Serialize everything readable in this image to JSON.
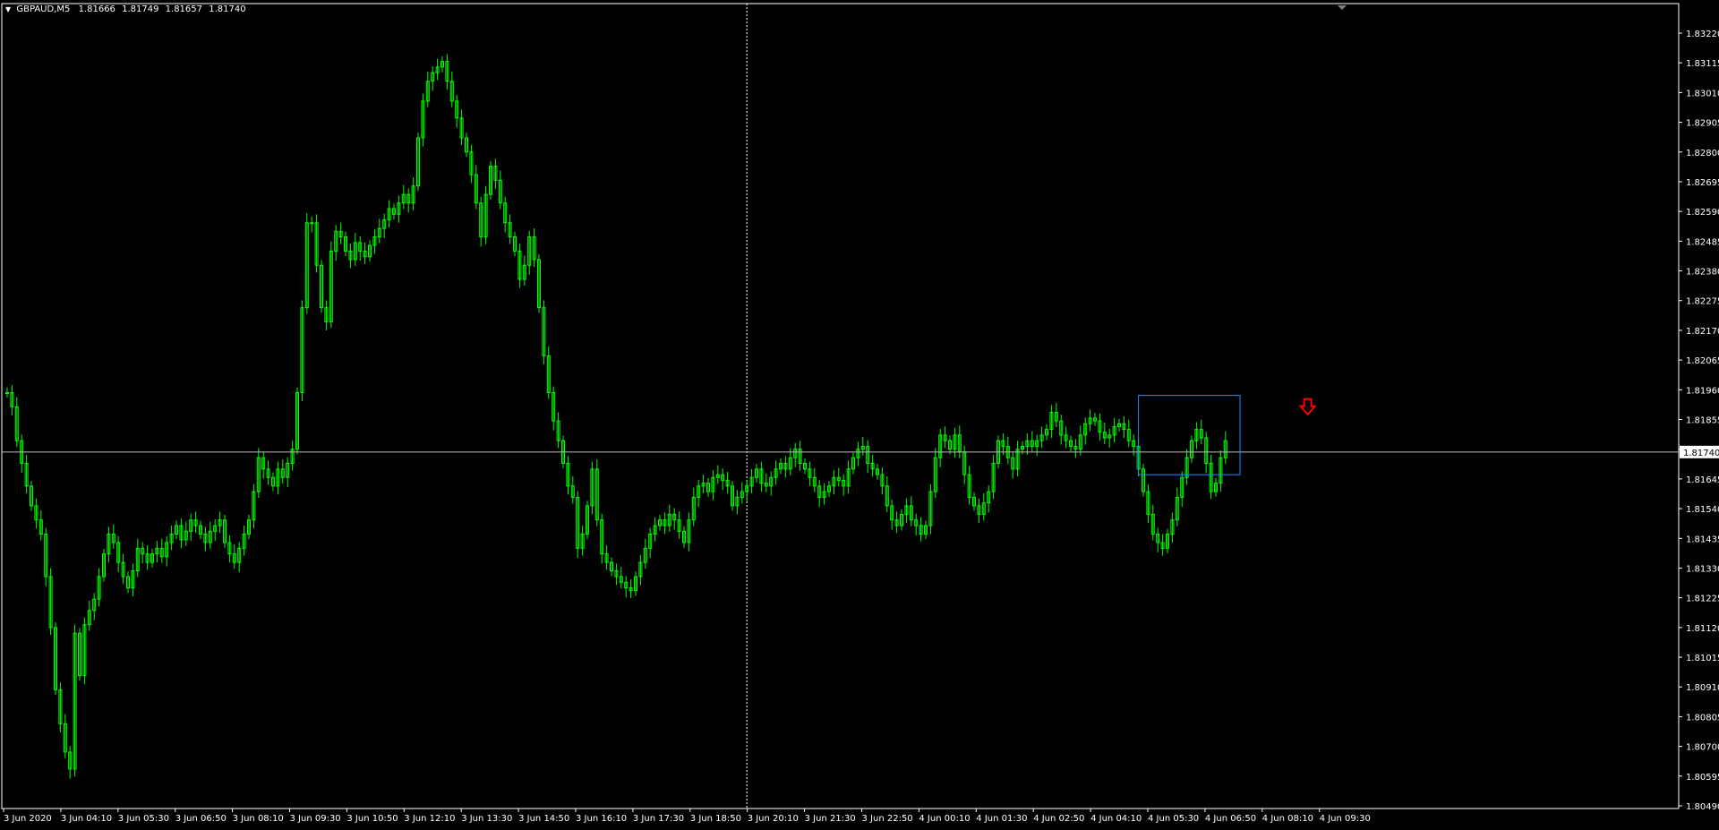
{
  "window": {
    "symbol": "GBPAUD,M5",
    "ohlc": [
      "1.81666",
      "1.81749",
      "1.81657",
      "1.81740"
    ]
  },
  "colors": {
    "background": "#000000",
    "candle": "#00ff00",
    "grid": "#ffffff",
    "current_price_line": "#c0c0c0",
    "rectangle": "#1e90ff",
    "arrow": "#ff0000",
    "axis_text": "#ffffff"
  },
  "chart_data": {
    "type": "line",
    "title": "GBPAUD,M5",
    "price_ticks": [
      "1.83220",
      "1.83115",
      "1.83010",
      "1.82905",
      "1.82800",
      "1.82695",
      "1.82590",
      "1.82485",
      "1.82380",
      "1.82275",
      "1.82170",
      "1.82065",
      "1.81960",
      "1.81855",
      "1.81750",
      "1.81645",
      "1.81540",
      "1.81435",
      "1.81330",
      "1.81225",
      "1.81120",
      "1.81015",
      "1.80910",
      "1.80805",
      "1.80700",
      "1.80595",
      "1.80490"
    ],
    "ylim": [
      1.8049,
      1.8322
    ],
    "current_price": "1.81740",
    "time_labels": [
      "3 Jun 2020",
      "3 Jun 04:10",
      "3 Jun 05:30",
      "3 Jun 06:50",
      "3 Jun 08:10",
      "3 Jun 09:30",
      "3 Jun 10:50",
      "3 Jun 12:10",
      "3 Jun 13:30",
      "3 Jun 14:50",
      "3 Jun 16:10",
      "3 Jun 17:30",
      "3 Jun 18:50",
      "3 Jun 20:10",
      "3 Jun 21:30",
      "3 Jun 22:50",
      "4 Jun 00:10",
      "4 Jun 01:30",
      "4 Jun 02:50",
      "4 Jun 04:10",
      "4 Jun 05:30",
      "4 Jun 06:50",
      "4 Jun 08:10",
      "4 Jun 09:30"
    ],
    "series": [
      {
        "values": [
          1.8195,
          1.819,
          1.8178,
          1.817,
          1.8162,
          1.8155,
          1.815,
          1.8145,
          1.813,
          1.8112,
          1.809,
          1.8078,
          1.8068,
          1.8062,
          1.811,
          1.8095,
          1.8113,
          1.8118,
          1.8122,
          1.813,
          1.8138,
          1.8145,
          1.8142,
          1.8135,
          1.813,
          1.8126,
          1.8132,
          1.814,
          1.8138,
          1.8135,
          1.8138,
          1.814,
          1.8137,
          1.8142,
          1.8145,
          1.8148,
          1.8143,
          1.8146,
          1.815,
          1.8148,
          1.8145,
          1.8142,
          1.8146,
          1.8148,
          1.815,
          1.8142,
          1.8138,
          1.8135,
          1.814,
          1.8145,
          1.815,
          1.816,
          1.8172,
          1.8168,
          1.8165,
          1.8162,
          1.8168,
          1.8165,
          1.817,
          1.8175,
          1.8195,
          1.8225,
          1.8255,
          1.8255,
          1.824,
          1.8225,
          1.822,
          1.8245,
          1.8252,
          1.825,
          1.8245,
          1.8242,
          1.8248,
          1.8245,
          1.8243,
          1.8247,
          1.825,
          1.8253,
          1.8256,
          1.826,
          1.8258,
          1.8262,
          1.8265,
          1.8262,
          1.8268,
          1.8285,
          1.8298,
          1.8305,
          1.8308,
          1.831,
          1.8312,
          1.8305,
          1.8298,
          1.8292,
          1.8285,
          1.828,
          1.8272,
          1.8262,
          1.825,
          1.8265,
          1.8275,
          1.827,
          1.8262,
          1.8255,
          1.825,
          1.8245,
          1.8235,
          1.824,
          1.825,
          1.8242,
          1.8225,
          1.8208,
          1.8195,
          1.8185,
          1.8178,
          1.817,
          1.8162,
          1.8158,
          1.814,
          1.8145,
          1.8155,
          1.8168,
          1.815,
          1.8138,
          1.8135,
          1.8132,
          1.813,
          1.8128,
          1.8126,
          1.8125,
          1.813,
          1.8135,
          1.814,
          1.8145,
          1.8148,
          1.815,
          1.8148,
          1.8152,
          1.815,
          1.8146,
          1.8142,
          1.815,
          1.8158,
          1.8162,
          1.8163,
          1.816,
          1.8165,
          1.8166,
          1.8164,
          1.8162,
          1.8155,
          1.8158,
          1.816,
          1.8162,
          1.8165,
          1.8168,
          1.8163,
          1.8162,
          1.8165,
          1.8168,
          1.817,
          1.8168,
          1.8172,
          1.8175,
          1.817,
          1.8168,
          1.8165,
          1.8162,
          1.8158,
          1.816,
          1.8162,
          1.8165,
          1.8164,
          1.8162,
          1.8168,
          1.8172,
          1.8175,
          1.8176,
          1.817,
          1.8168,
          1.8166,
          1.8162,
          1.8155,
          1.815,
          1.8148,
          1.8152,
          1.8155,
          1.815,
          1.8148,
          1.8145,
          1.8148,
          1.816,
          1.8172,
          1.818,
          1.8178,
          1.8175,
          1.818,
          1.8174,
          1.8166,
          1.8158,
          1.8155,
          1.8152,
          1.8156,
          1.816,
          1.817,
          1.8178,
          1.8176,
          1.8172,
          1.8168,
          1.8175,
          1.8176,
          1.8178,
          1.8176,
          1.8178,
          1.818,
          1.8182,
          1.8188,
          1.8185,
          1.818,
          1.8178,
          1.8176,
          1.8175,
          1.818,
          1.8184,
          1.8186,
          1.8185,
          1.8181,
          1.8179,
          1.818,
          1.8183,
          1.8184,
          1.8182,
          1.8178,
          1.8176,
          1.8168,
          1.816,
          1.8152,
          1.8145,
          1.8142,
          1.814,
          1.8145,
          1.815,
          1.8158,
          1.8165,
          1.8172,
          1.8178,
          1.8182,
          1.8179,
          1.817,
          1.816,
          1.8163,
          1.8172,
          1.8178
        ]
      }
    ],
    "annotations": [
      {
        "type": "rectangle",
        "from_index": 234,
        "to_index": 255,
        "ylim": [
          1.8166,
          1.8194
        ]
      },
      {
        "type": "arrow-down",
        "index": 269,
        "value": 1.8187
      }
    ]
  }
}
